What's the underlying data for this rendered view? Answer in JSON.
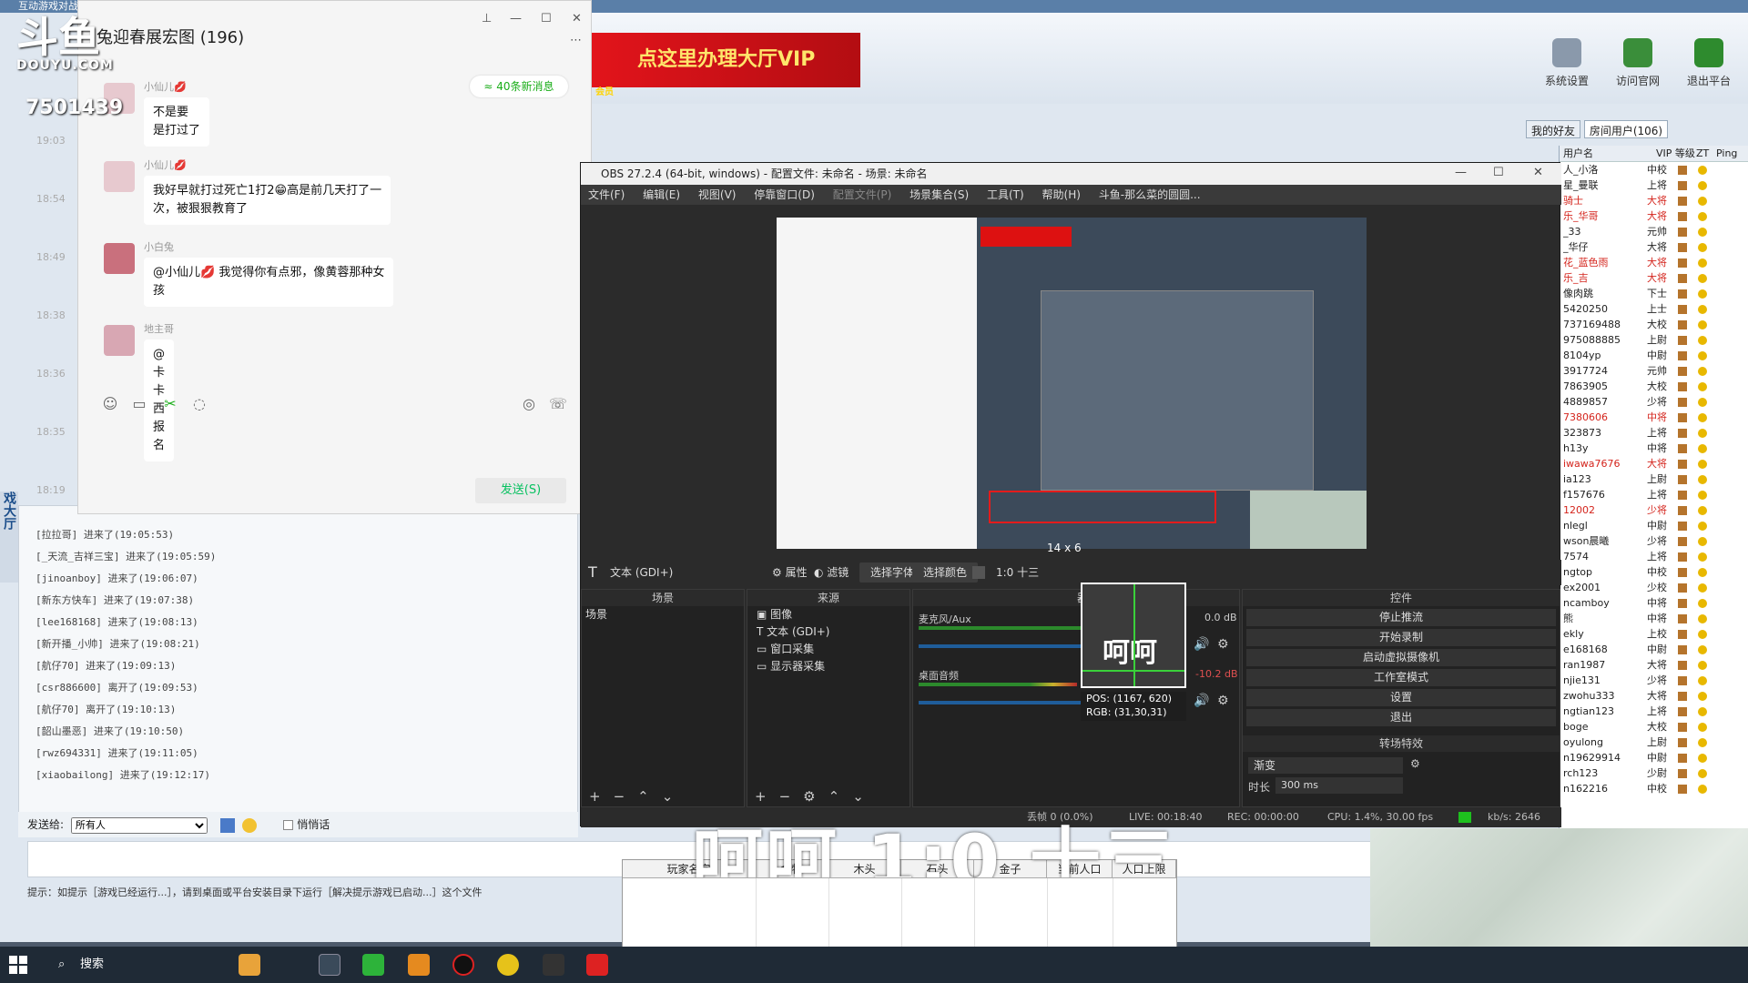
{
  "platform": {
    "title_text": "互动游戏对战平台 4.70 (请使用已开端...未来)",
    "vip_banner": "点这里办理大厅VIP",
    "vip_tag": "会员",
    "tools": [
      {
        "label": "系统设置",
        "icon": "gear-icon",
        "color": "#6b7a8c"
      },
      {
        "label": "访问官网",
        "icon": "home-icon",
        "color": "#3a8e3a"
      },
      {
        "label": "退出平台",
        "icon": "exit-icon",
        "color": "#2e8b2e"
      }
    ],
    "tabs": [
      "我的好友",
      "房间用户(106)"
    ],
    "user_list_headers": [
      "用户名",
      "VIP 等级",
      "ZT",
      "Ping"
    ],
    "users": [
      {
        "name": "人_小洛",
        "rank": "中校",
        "red": false
      },
      {
        "name": "星_曼联",
        "rank": "上将",
        "red": false
      },
      {
        "name": "骑士",
        "rank": "大将",
        "red": true
      },
      {
        "name": "乐_华哥",
        "rank": "大将",
        "red": true
      },
      {
        "name": "_33",
        "rank": "元帅",
        "red": false
      },
      {
        "name": "_华仔",
        "rank": "大将",
        "red": false
      },
      {
        "name": "花_蓝色雨",
        "rank": "大将",
        "red": true
      },
      {
        "name": "乐_吉",
        "rank": "大将",
        "red": true
      },
      {
        "name": "像肉跳",
        "rank": "下士",
        "red": false
      },
      {
        "name": "5420250",
        "rank": "上士",
        "red": false
      },
      {
        "name": "737169488",
        "rank": "大校",
        "red": false
      },
      {
        "name": "975088885",
        "rank": "上尉",
        "red": false
      },
      {
        "name": "8104yp",
        "rank": "中尉",
        "red": false
      },
      {
        "name": "3917724",
        "rank": "元帅",
        "red": false
      },
      {
        "name": "7863905",
        "rank": "大校",
        "red": false
      },
      {
        "name": "4889857",
        "rank": "少将",
        "red": false
      },
      {
        "name": "7380606",
        "rank": "中将",
        "red": true
      },
      {
        "name": "323873",
        "rank": "上将",
        "red": false
      },
      {
        "name": "h13y",
        "rank": "中将",
        "red": false
      },
      {
        "name": "iwawa7676",
        "rank": "大将",
        "red": true
      },
      {
        "name": "ia123",
        "rank": "上尉",
        "red": false
      },
      {
        "name": "f157676",
        "rank": "上将",
        "red": false
      },
      {
        "name": "12002",
        "rank": "少将",
        "red": true
      },
      {
        "name": "nlegl",
        "rank": "中尉",
        "red": false
      },
      {
        "name": "wson晨曦",
        "rank": "少将",
        "red": false
      },
      {
        "name": "7574",
        "rank": "上将",
        "red": false
      },
      {
        "name": "ngtop",
        "rank": "中校",
        "red": false
      },
      {
        "name": "ex2001",
        "rank": "少校",
        "red": false
      },
      {
        "name": "ncamboy",
        "rank": "中将",
        "red": false
      },
      {
        "name": "熊",
        "rank": "中将",
        "red": false
      },
      {
        "name": "ekly",
        "rank": "上校",
        "red": false
      },
      {
        "name": "e168168",
        "rank": "中尉",
        "red": false
      },
      {
        "name": "ran1987",
        "rank": "大将",
        "red": false
      },
      {
        "name": "njie131",
        "rank": "少将",
        "red": false
      },
      {
        "name": "zwohu333",
        "rank": "大将",
        "red": false
      },
      {
        "name": "ngtian123",
        "rank": "上将",
        "red": false
      },
      {
        "name": "boge",
        "rank": "大校",
        "red": false
      },
      {
        "name": "oyulong",
        "rank": "上尉",
        "red": false
      },
      {
        "name": "n19629914",
        "rank": "中尉",
        "red": false
      },
      {
        "name": "rch123",
        "rank": "少尉",
        "red": false
      },
      {
        "name": "n162216",
        "rank": "中校",
        "red": false
      }
    ],
    "join_log": [
      "[拉拉哥] 进来了(19:05:53)",
      "[_天流_吉祥三宝] 进来了(19:05:59)",
      "[jinoanboy] 进来了(19:06:07)",
      "[新东方快车] 进来了(19:07:38)",
      "[lee168168] 进来了(19:08:13)",
      "[新开播_小帅] 进来了(19:08:21)",
      "[航仔70] 进来了(19:09:13)",
      "[csr886600] 离开了(19:09:53)",
      "[航仔70] 离开了(19:10:13)",
      "[韶山墨恶] 进来了(19:10:50)",
      "[rwz694331] 进来了(19:11:05)",
      "[xiaobailong] 进来了(19:12:17)"
    ],
    "send_to_label": "发送给:",
    "send_to_value": "所有人",
    "whisper_label": "悄悄话",
    "hint_text": "提示：如提示［游戏已经运行...］，请到桌面或平台安装目录下运行［解决提示游戏已启动...］这个文件",
    "side_text": "戏大厅"
  },
  "douyu": {
    "logo": "斗鱼",
    "logo_sub": "DOUYU.COM",
    "room_id": "7501439"
  },
  "chat": {
    "title": "兔迎春展宏图 (196)",
    "new_msg": "≈ 40条新消息",
    "send_button": "发送(S)",
    "timestamps": [
      "19:03",
      "18:54",
      "18:49",
      "18:38",
      "18:36",
      "18:35",
      "18:19"
    ],
    "messages": [
      {
        "name": "小仙儿💋",
        "text": "不是要\n是打过了"
      },
      {
        "name": "小仙儿💋",
        "text": "我好早就打过死亡1打2😁高是前几天打了一\n次，被狠狠教育了"
      },
      {
        "name": "小白兔",
        "text": "@小仙儿💋 我觉得你有点邪，像黄蓉那种女\n孩"
      },
      {
        "name": "地主哥",
        "text": "@卡卡西 报名"
      }
    ]
  },
  "obs": {
    "title": "OBS 27.2.4 (64-bit, windows) - 配置文件: 未命名 - 场景: 未命名",
    "menu": [
      "文件(F)",
      "编辑(E)",
      "视图(V)",
      "停靠窗口(D)",
      "配置文件(P)",
      "场景集合(S)",
      "工具(T)",
      "帮助(H)",
      "斗鱼-那么菜的圆圆..."
    ],
    "source_type": "文本 (GDI+)",
    "props_btn": "属性",
    "filters_btn": "滤镜",
    "font_btn": "选择字体",
    "color_btn": "选择颜色",
    "text_value": "1:0 十三",
    "size_label": "14 x 6",
    "scenes_header": "场景",
    "scene_item": "场景",
    "sources_header": "来源",
    "sources": [
      {
        "name": "图像",
        "icon": "image-icon"
      },
      {
        "name": "文本 (GDI+)",
        "icon": "text-icon"
      },
      {
        "name": "窗口采集",
        "icon": "window-icon"
      },
      {
        "name": "显示器采集",
        "icon": "monitor-icon"
      }
    ],
    "mixer_header": "器",
    "mixer_tracks": [
      {
        "name": "麦克风/Aux",
        "db": "0.0 dB",
        "level": 0.92
      },
      {
        "name": "桌面音频",
        "db": "-10.2 dB",
        "level": 0.6
      }
    ],
    "controls_header": "控件",
    "controls": [
      "停止推流",
      "开始录制",
      "启动虚拟摄像机",
      "工作室模式",
      "设置",
      "退出"
    ],
    "transitions_header": "转场特效",
    "transition": "渐变",
    "duration_label": "时长",
    "duration": "300 ms",
    "status": {
      "dropped": "丢帧 0 (0.0%)",
      "live": "LIVE: 00:18:40",
      "rec": "REC: 00:00:00",
      "cpu": "CPU: 1.4%, 30.00 fps",
      "kbs": "kb/s: 2646"
    },
    "magnifier": {
      "text": "呵呵",
      "pos": "POS: (1167, 620)",
      "rgb": "RGB: (31,30,31)"
    }
  },
  "overlay_text": "呵呵 1:0 十三",
  "game_table": {
    "headers": [
      "玩家名字",
      "食物",
      "木头",
      "石头",
      "金子",
      "当前人口",
      "人口上限"
    ]
  },
  "taskbar": {
    "search": "搜索"
  }
}
